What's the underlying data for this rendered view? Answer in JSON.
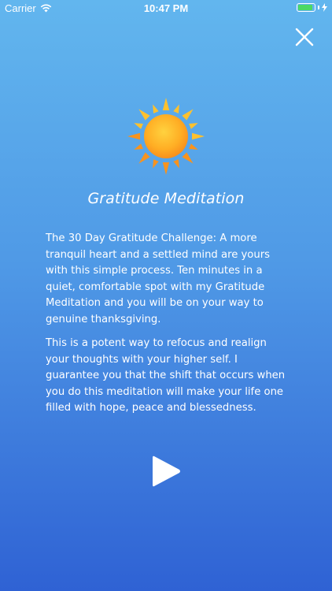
{
  "status_bar": {
    "carrier": "Carrier",
    "time": "10:47 PM",
    "battery_level": 0.9,
    "battery_color": "#4cd964"
  },
  "header": {
    "close_icon": "close-icon"
  },
  "hero": {
    "icon": "sun-icon",
    "title": "Gratitude Meditation"
  },
  "content": {
    "paragraph_1": "The 30 Day Gratitude Challenge: A more tranquil heart and a settled mind are yours with this simple process. Ten minutes in a quiet, comfortable spot with my Gratitude Meditation and you will be on your way to genuine thanksgiving.",
    "paragraph_2": "This is a potent way to refocus and realign your thoughts with your higher self. I guarantee you that the shift that occurs when you do this meditation will make your life one filled with hope, peace and blessedness."
  },
  "controls": {
    "play_icon": "play-icon"
  },
  "colors": {
    "gradient_top": "#62b6ee",
    "gradient_bottom": "#2f62d4",
    "sun_inner": "#ffbe2e",
    "sun_outer": "#f7901e"
  }
}
